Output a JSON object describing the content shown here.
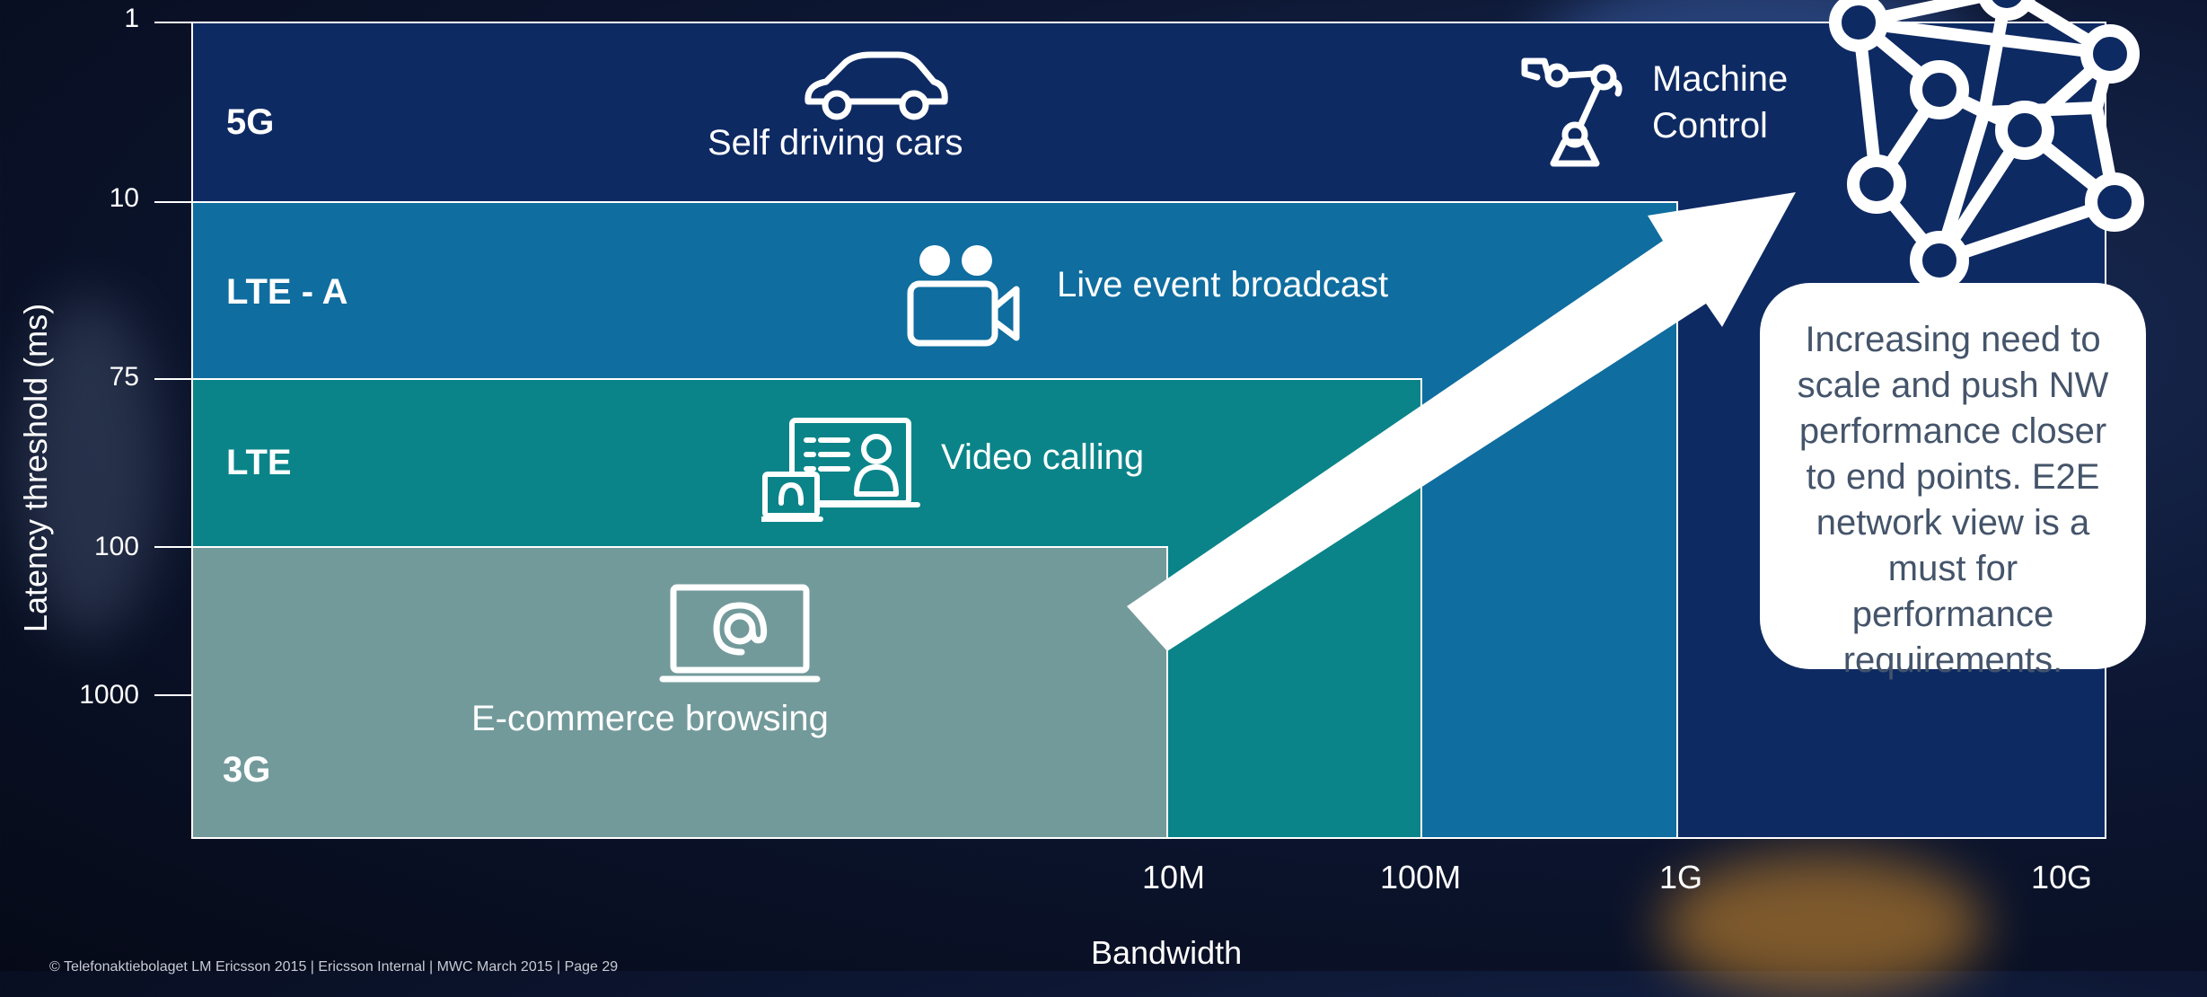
{
  "axis": {
    "y_title": "Latency threshold (ms)",
    "x_title": "Bandwidth",
    "y_ticks": [
      "1",
      "10",
      "75",
      "100",
      "1000"
    ],
    "x_ticks": [
      "10M",
      "100M",
      "1G",
      "10G"
    ]
  },
  "generations": [
    {
      "label": "5G",
      "use_case": "Self driving cars",
      "color": "#0e2a63"
    },
    {
      "label": "LTE - A",
      "use_case": "Live event broadcast",
      "color": "#0f6d9f"
    },
    {
      "label": "LTE",
      "use_case": "Video calling",
      "color": "#0a8489"
    },
    {
      "label": "3G",
      "use_case": "E-commerce browsing",
      "color": "#739a9b"
    }
  ],
  "machine_control": {
    "line1": "Machine",
    "line2": "Control"
  },
  "callout": "Increasing need to scale and push NW performance closer to end points. E2E network view is a must for performance requirements.",
  "footer": "© Telefonaktiebolaget LM Ericsson 2015 | Ericsson Internal | MWC March 2015 | Page 29",
  "icons": [
    "car-icon",
    "robot-arm-icon",
    "camera-icon",
    "video-call-icon",
    "laptop-at-icon",
    "network-mesh-icon",
    "arrow-icon"
  ]
}
